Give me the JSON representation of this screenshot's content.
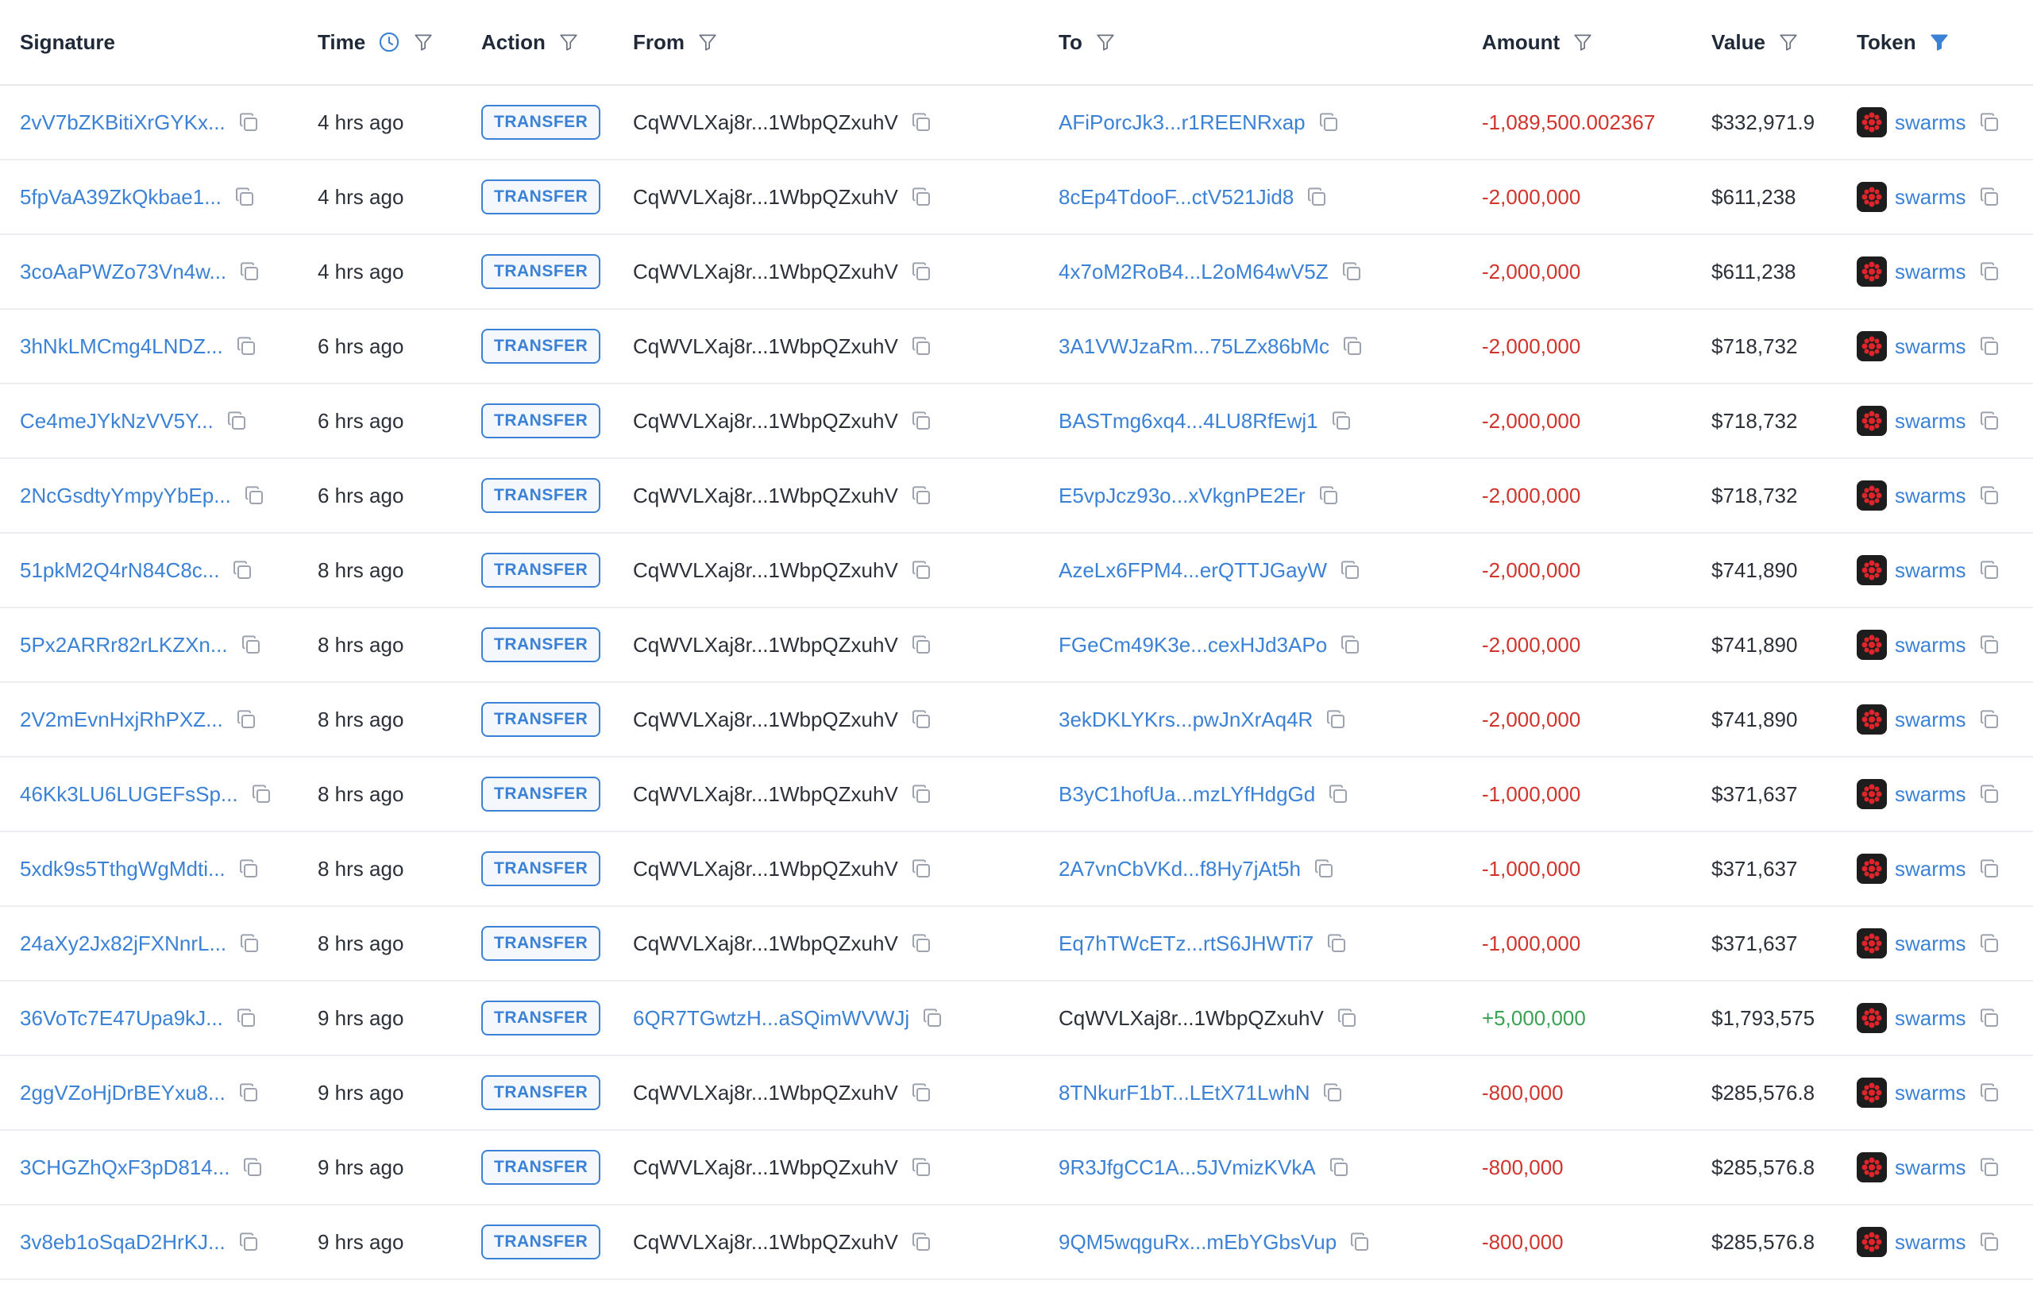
{
  "header": {
    "signature": "Signature",
    "time": "Time",
    "action": "Action",
    "from": "From",
    "to": "To",
    "amount": "Amount",
    "value": "Value",
    "token": "Token"
  },
  "colors": {
    "link": "#3b82d6",
    "negative": "#d0342c",
    "positive": "#3ba153",
    "active_filter": "#3b82d6"
  },
  "rows": [
    {
      "signature": "2vV7bZKBitiXrGYKx...",
      "time": "4 hrs ago",
      "action": "TRANSFER",
      "from": "CqWVLXaj8r...1WbpQZxuhV",
      "to": "AFiPorcJk3...r1REENRxap",
      "amount": "-1,089,500.002367",
      "value": "$332,971.9",
      "token": "swarms"
    },
    {
      "signature": "5fpVaA39ZkQkbae1...",
      "time": "4 hrs ago",
      "action": "TRANSFER",
      "from": "CqWVLXaj8r...1WbpQZxuhV",
      "to": "8cEp4TdooF...ctV521Jid8",
      "amount": "-2,000,000",
      "value": "$611,238",
      "token": "swarms"
    },
    {
      "signature": "3coAaPWZo73Vn4w...",
      "time": "4 hrs ago",
      "action": "TRANSFER",
      "from": "CqWVLXaj8r...1WbpQZxuhV",
      "to": "4x7oM2RoB4...L2oM64wV5Z",
      "amount": "-2,000,000",
      "value": "$611,238",
      "token": "swarms"
    },
    {
      "signature": "3hNkLMCmg4LNDZ...",
      "time": "6 hrs ago",
      "action": "TRANSFER",
      "from": "CqWVLXaj8r...1WbpQZxuhV",
      "to": "3A1VWJzaRm...75LZx86bMc",
      "amount": "-2,000,000",
      "value": "$718,732",
      "token": "swarms"
    },
    {
      "signature": "Ce4meJYkNzVV5Y...",
      "time": "6 hrs ago",
      "action": "TRANSFER",
      "from": "CqWVLXaj8r...1WbpQZxuhV",
      "to": "BASTmg6xq4...4LU8RfEwj1",
      "amount": "-2,000,000",
      "value": "$718,732",
      "token": "swarms"
    },
    {
      "signature": "2NcGsdtyYmpyYbEp...",
      "time": "6 hrs ago",
      "action": "TRANSFER",
      "from": "CqWVLXaj8r...1WbpQZxuhV",
      "to": "E5vpJcz93o...xVkgnPE2Er",
      "amount": "-2,000,000",
      "value": "$718,732",
      "token": "swarms"
    },
    {
      "signature": "51pkM2Q4rN84C8c...",
      "time": "8 hrs ago",
      "action": "TRANSFER",
      "from": "CqWVLXaj8r...1WbpQZxuhV",
      "to": "AzeLx6FPM4...erQTTJGayW",
      "amount": "-2,000,000",
      "value": "$741,890",
      "token": "swarms"
    },
    {
      "signature": "5Px2ARRr82rLKZXn...",
      "time": "8 hrs ago",
      "action": "TRANSFER",
      "from": "CqWVLXaj8r...1WbpQZxuhV",
      "to": "FGeCm49K3e...cexHJd3APo",
      "amount": "-2,000,000",
      "value": "$741,890",
      "token": "swarms"
    },
    {
      "signature": "2V2mEvnHxjRhPXZ...",
      "time": "8 hrs ago",
      "action": "TRANSFER",
      "from": "CqWVLXaj8r...1WbpQZxuhV",
      "to": "3ekDKLYKrs...pwJnXrAq4R",
      "amount": "-2,000,000",
      "value": "$741,890",
      "token": "swarms"
    },
    {
      "signature": "46Kk3LU6LUGEFsSp...",
      "time": "8 hrs ago",
      "action": "TRANSFER",
      "from": "CqWVLXaj8r...1WbpQZxuhV",
      "to": "B3yC1hofUa...mzLYfHdgGd",
      "amount": "-1,000,000",
      "value": "$371,637",
      "token": "swarms"
    },
    {
      "signature": "5xdk9s5TthgWgMdti...",
      "time": "8 hrs ago",
      "action": "TRANSFER",
      "from": "CqWVLXaj8r...1WbpQZxuhV",
      "to": "2A7vnCbVKd...f8Hy7jAt5h",
      "amount": "-1,000,000",
      "value": "$371,637",
      "token": "swarms"
    },
    {
      "signature": "24aXy2Jx82jFXNnrL...",
      "time": "8 hrs ago",
      "action": "TRANSFER",
      "from": "CqWVLXaj8r...1WbpQZxuhV",
      "to": "Eq7hTWcETz...rtS6JHWTi7",
      "amount": "-1,000,000",
      "value": "$371,637",
      "token": "swarms"
    },
    {
      "signature": "36VoTc7E47Upa9kJ...",
      "time": "9 hrs ago",
      "action": "TRANSFER",
      "from": "6QR7TGwtzH...aSQimWVWJj",
      "to": "CqWVLXaj8r...1WbpQZxuhV",
      "amount": "+5,000,000",
      "value": "$1,793,575",
      "token": "swarms"
    },
    {
      "signature": "2ggVZoHjDrBEYxu8...",
      "time": "9 hrs ago",
      "action": "TRANSFER",
      "from": "CqWVLXaj8r...1WbpQZxuhV",
      "to": "8TNkurF1bT...LEtX71LwhN",
      "amount": "-800,000",
      "value": "$285,576.8",
      "token": "swarms"
    },
    {
      "signature": "3CHGZhQxF3pD814...",
      "time": "9 hrs ago",
      "action": "TRANSFER",
      "from": "CqWVLXaj8r...1WbpQZxuhV",
      "to": "9R3JfgCC1A...5JVmizKVkA",
      "amount": "-800,000",
      "value": "$285,576.8",
      "token": "swarms"
    },
    {
      "signature": "3v8eb1oSqaD2HrKJ...",
      "time": "9 hrs ago",
      "action": "TRANSFER",
      "from": "CqWVLXaj8r...1WbpQZxuhV",
      "to": "9QM5wqguRx...mEbYGbsVup",
      "amount": "-800,000",
      "value": "$285,576.8",
      "token": "swarms"
    }
  ]
}
